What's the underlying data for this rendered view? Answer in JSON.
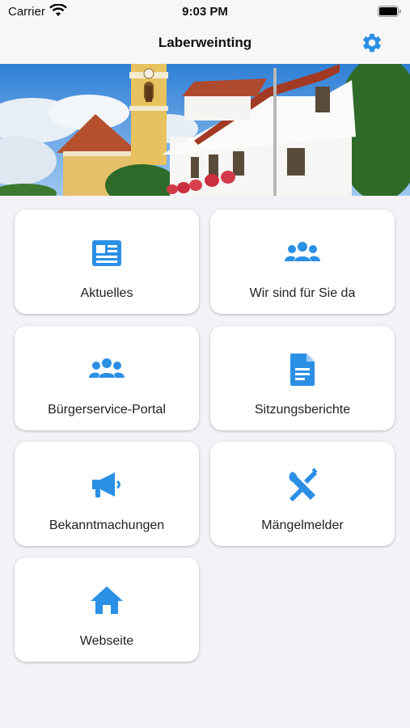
{
  "status": {
    "carrier": "Carrier",
    "time": "9:03 PM"
  },
  "nav": {
    "title": "Laberweinting"
  },
  "colors": {
    "accent": "#2b8fe6",
    "background": "#f2f2f7"
  },
  "tiles": [
    {
      "label": "Aktuelles",
      "icon": "newspaper-icon"
    },
    {
      "label": "Wir sind für Sie da",
      "icon": "people-group-icon"
    },
    {
      "label": "Bürgerservice-Portal",
      "icon": "people-group-icon"
    },
    {
      "label": "Sitzungsberichte",
      "icon": "document-icon"
    },
    {
      "label": "Bekanntmachungen",
      "icon": "megaphone-icon"
    },
    {
      "label": "Mängelmelder",
      "icon": "tools-icon"
    },
    {
      "label": "Webseite",
      "icon": "home-icon"
    }
  ]
}
